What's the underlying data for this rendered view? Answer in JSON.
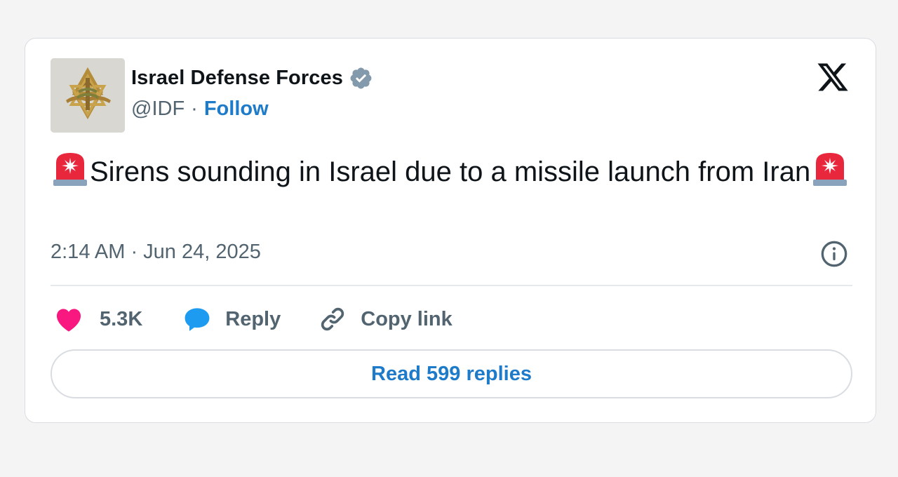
{
  "author": {
    "name": "Israel Defense Forces",
    "handle": "@IDF",
    "separator": "·",
    "follow_label": "Follow",
    "verified": true,
    "verified_color": "#829aab"
  },
  "tweet": {
    "emoji_icon": "police-siren-icon",
    "text": "Sirens sounding in Israel due to a missile launch from Iran",
    "timestamp": "2:14 AM · Jun 24, 2025"
  },
  "actions": {
    "like_count": "5.3K",
    "reply_label": "Reply",
    "copy_link_label": "Copy link"
  },
  "read_replies_label": "Read 599 replies",
  "colors": {
    "accent": "#1d7bc9",
    "like": "#f91880",
    "reply": "#1d9bf0",
    "muted": "#536471",
    "text": "#0f1419",
    "background": "#f4f4f5"
  },
  "icons": {
    "brand": "x-logo-icon",
    "info": "info-icon",
    "like": "heart-icon",
    "reply": "speech-bubble-icon",
    "copy": "link-icon"
  }
}
